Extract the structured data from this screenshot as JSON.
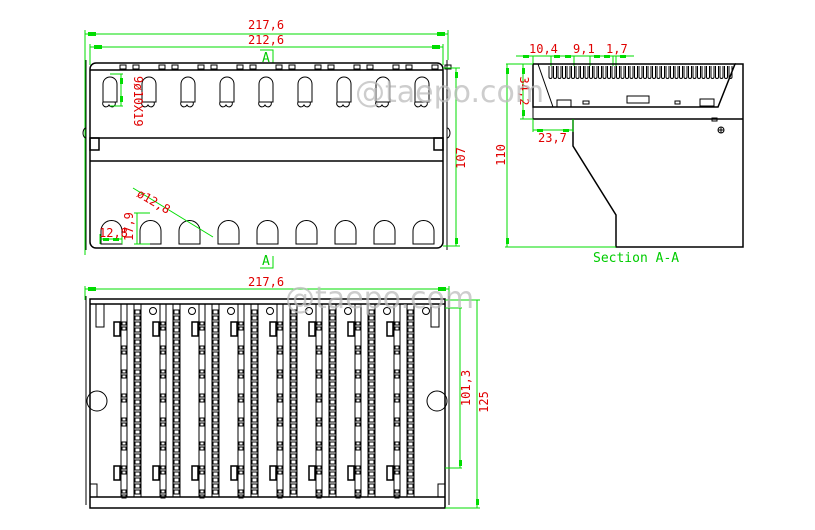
{
  "watermark": "@taepo.com",
  "top_view": {
    "dim_overall_width": "217,6",
    "dim_inner_width": "212,6",
    "section_marker_top": "A",
    "section_marker_bottom": "A",
    "dim_slot": "9ø10X19",
    "dim_hole_diameter": "ø12,8",
    "dim_hole_width": "12,8",
    "dim_hole_height": "17,9",
    "dim_height": "107",
    "top_slot_count": 9,
    "bottom_hole_count": 9
  },
  "section_view": {
    "title": "Section A-A",
    "dim_pitch_1": "10,4",
    "dim_pitch_2": "9,1",
    "dim_pitch_3": "1,7",
    "dim_upper_height": "34,2",
    "dim_step": "23,7",
    "dim_total_height": "110"
  },
  "front_view": {
    "dim_overall_width": "217,6",
    "dim_inner_height": "101,3",
    "dim_total_height": "125",
    "module_count": 8
  },
  "colors": {
    "dimension_line": "#00dd00",
    "dimension_text": "#e00000",
    "outline": "#000000"
  }
}
